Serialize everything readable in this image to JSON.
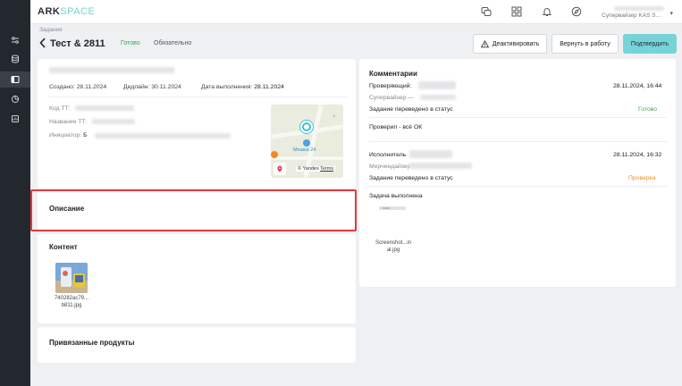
{
  "colors": {
    "accent": "#78d3d8",
    "ok_green": "#3aa655",
    "warn_orange": "#f08a24",
    "highlight_red": "#e0393e",
    "sidebar_bg": "#23272e"
  },
  "header": {
    "logo_main": "ARK",
    "logo_accent": "SPACE",
    "icons": [
      "chat-icon",
      "apps-grid-icon",
      "bell-icon",
      "compass-icon",
      "user-avatar-icon"
    ],
    "user_role": "Супервайзер KAS S...",
    "user_menu_icon": "chevron-down-icon"
  },
  "sidebar": {
    "items": [
      {
        "icon": "sliders-icon",
        "active": false
      },
      {
        "icon": "database-icon",
        "active": false
      },
      {
        "icon": "tasks-panel-icon",
        "active": true
      },
      {
        "icon": "pie-chart-icon",
        "active": false
      },
      {
        "icon": "report-icon",
        "active": false
      }
    ]
  },
  "page": {
    "breadcrumb": "Задания",
    "title": "Тест & 2811",
    "status": "Готово",
    "required": "Обязательно",
    "back_icon": "chevron-left-icon"
  },
  "actions": {
    "deactivate": "Деактивировать",
    "deactivate_icon": "warning-icon",
    "return": "Вернуть в работу",
    "confirm": "Подтвердить"
  },
  "task": {
    "created": "Создано: 28.11.2024",
    "deadline": "Дедлайн: 30.11.2024",
    "done_label": "Дата выполнения:",
    "done_date": "28.11.2024",
    "fields": {
      "code": "Код ТТ:",
      "name": "Название ТТ:",
      "initiator": "Инициатор:",
      "initiator_initial": "Б"
    },
    "map": {
      "place": "Мешка 24",
      "attribution": "© Yandex",
      "terms": "Terms"
    },
    "description_title": "Описание",
    "content_title": "Контент",
    "content_file": "740282ac79... b811.jpg",
    "products_title": "Привязанные продукты"
  },
  "comments": {
    "title": "Комментарии",
    "entries": [
      {
        "role": "Проверяющий:",
        "timestamp": "28.11.2024, 16:44",
        "sub_role": "Супервайзер —",
        "status_text": "Задание переведено в статус",
        "status_value": "Готово",
        "comment": "Проверил - всё ОК"
      },
      {
        "role": "Исполнитель",
        "timestamp": "28.11.2024, 16:32",
        "sub_role": "Мерчендайзер",
        "status_text": "Задание переведено в статус",
        "status_value": "Проверка",
        "comment": "Задача выполнена",
        "attachment": "Screenshot...in al.jpg"
      }
    ]
  }
}
